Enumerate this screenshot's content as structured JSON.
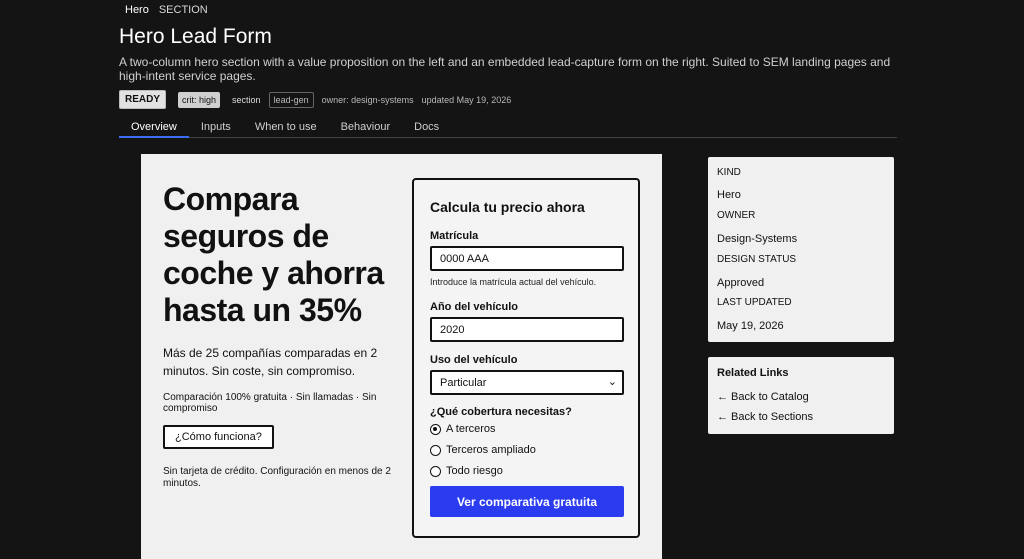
{
  "breadcrumb": {
    "item1": "Hero",
    "item2": "SECTION"
  },
  "page": {
    "title": "Hero Lead Form",
    "description": "A two-column hero section with a value proposition on the left and an embedded lead-capture form on the right. Suited to SEM landing pages and high-intent service pages."
  },
  "meta": {
    "status": "READY",
    "criticality": "crit: high",
    "type": "section",
    "tag": "lead-gen",
    "owner_text": "owner: design-systems",
    "updated_text": "updated May 19, 2026"
  },
  "tabs": [
    "Overview",
    "Inputs",
    "When to use",
    "Behaviour",
    "Docs"
  ],
  "hero": {
    "heading": "Compara seguros de coche y ahorra hasta un 35%",
    "subheading": "Más de 25 compañías comparadas en 2 minutos. Sin coste, sin compromiso.",
    "features": "Comparación 100% gratuita · Sin llamadas · Sin compromiso",
    "how_button": "¿Cómo funciona?",
    "note": "Sin tarjeta de crédito. Configuración en menos de 2 minutos."
  },
  "form": {
    "title": "Calcula tu precio ahora",
    "plate_label": "Matrícula",
    "plate_value": "0000 AAA",
    "plate_hint": "Introduce la matrícula actual del vehículo.",
    "year_label": "Año del vehículo",
    "year_value": "2020",
    "use_label": "Uso del vehículo",
    "use_value": "Particular",
    "coverage_label": "¿Qué cobertura necesitas?",
    "coverage_options": [
      "A terceros",
      "Terceros ampliado",
      "Todo riesgo"
    ],
    "coverage_selected": "A terceros",
    "submit_label": "Ver comparativa gratuita"
  },
  "sidebar": {
    "kind_label": "KIND",
    "kind_value": "Hero",
    "owner_label": "OWNER",
    "owner_value": "Design-Systems",
    "status_label": "DESIGN STATUS",
    "status_value": "Approved",
    "updated_label": "LAST UPDATED",
    "updated_value": "May 19, 2026"
  },
  "related": {
    "title": "Related Links",
    "links": [
      "← Back to Catalog",
      "← Back to Sections"
    ]
  },
  "colors": {
    "accent": "#3b6df0",
    "cta": "#2a3bf0",
    "background": "#141414",
    "card": "#f0f0f0"
  }
}
